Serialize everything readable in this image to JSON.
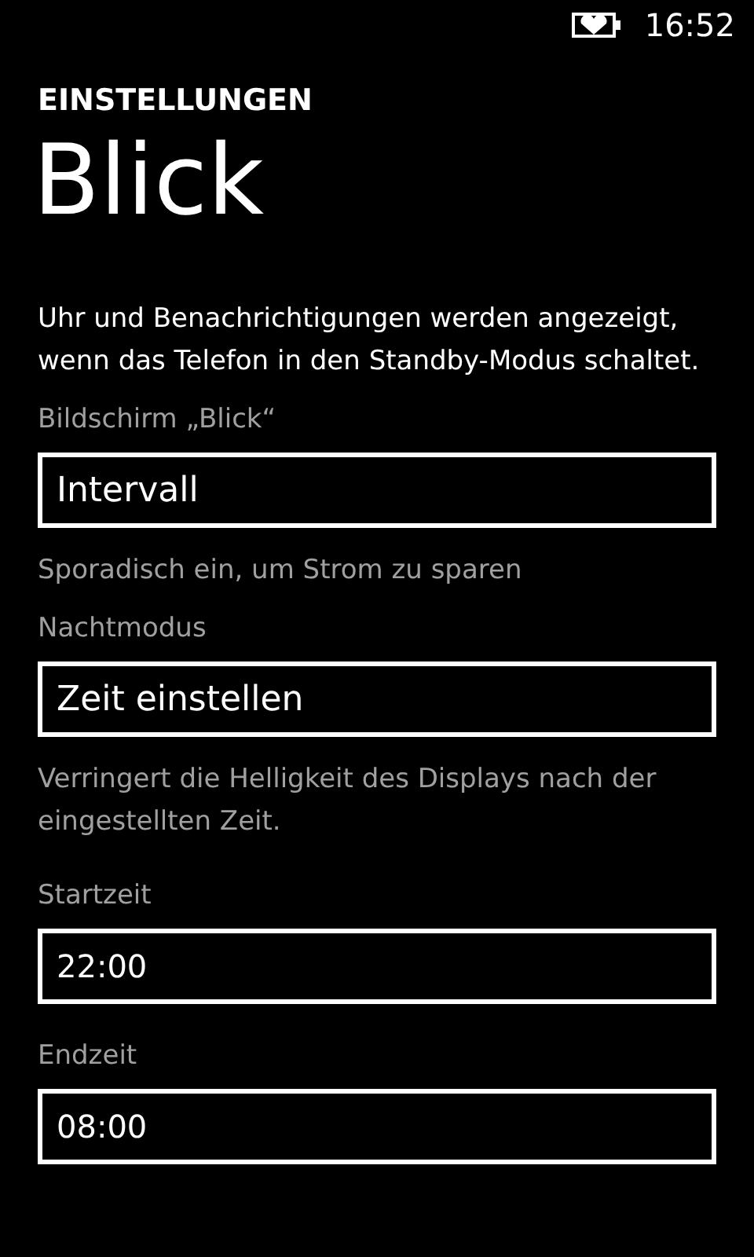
{
  "status_bar": {
    "time": "16:52"
  },
  "header": {
    "category": "EINSTELLUNGEN",
    "title": "Blick"
  },
  "description": "Uhr und Benachrichtigungen werden angezeigt, wenn das Telefon in den Standby-Modus schaltet.",
  "fields": [
    {
      "kind": "picker",
      "label": "Bildschirm „Blick“",
      "value": "Intervall",
      "hint": "Sporadisch ein, um Strom zu sparen"
    },
    {
      "kind": "picker",
      "label": "Nachtmodus",
      "value": "Zeit einstellen",
      "hint": "Verringert die Helligkeit des Displays nach der eingestellten Zeit."
    },
    {
      "kind": "time",
      "label": "Startzeit",
      "value": "22:00"
    },
    {
      "kind": "time",
      "label": "Endzeit",
      "value": "08:00"
    }
  ]
}
